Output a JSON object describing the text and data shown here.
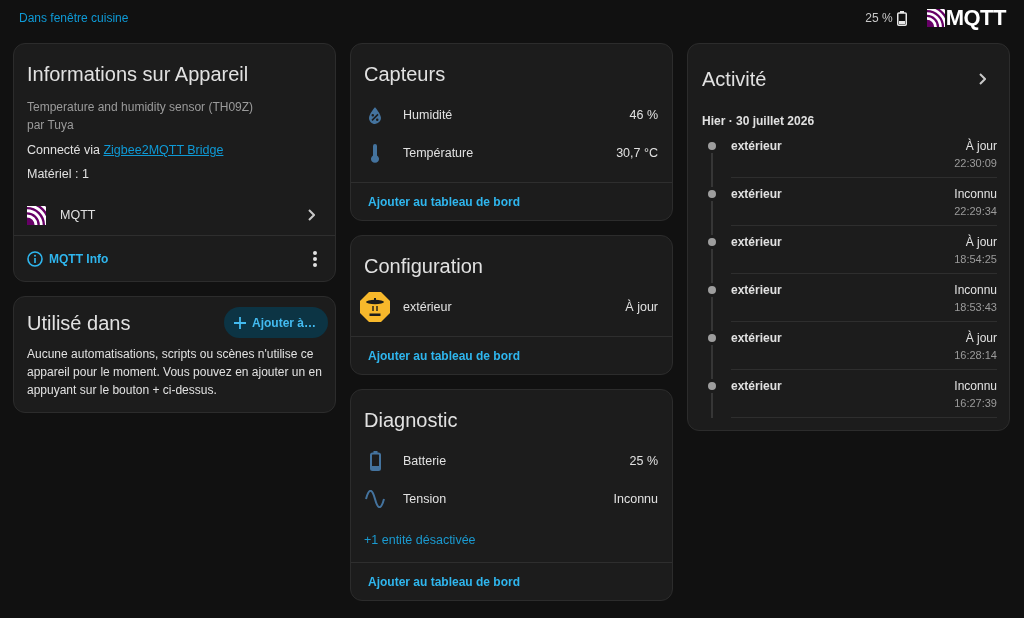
{
  "header": {
    "area": "Dans fenêtre cuisine",
    "battery": "25 %",
    "brand": "MQTT"
  },
  "device_info": {
    "title": "Informations sur Appareil",
    "model": "Temperature and humidity sensor (TH09Z)",
    "manufacturer": "par Tuya",
    "connection": {
      "label": "Connecté via",
      "link": "Zigbee2MQTT Bridge"
    },
    "hardware": "Matériel : 1",
    "integration": "MQTT",
    "action": "MQTT Info"
  },
  "used_in": {
    "title": "Utilisé dans",
    "button": "Ajouter à…",
    "message": "Aucune automatisations, scripts ou scènes n'utilise ce appareil pour le moment. Vous pouvez en ajouter un en appuyant sur le bouton + ci-dessus."
  },
  "sensors": {
    "title": "Capteurs",
    "entities": [
      {
        "kind": "humidity",
        "name": "Humidité",
        "value": "46 %"
      },
      {
        "kind": "temperature",
        "name": "Température",
        "value": "30,7 °C"
      }
    ],
    "footer_link": "Ajouter au tableau de bord"
  },
  "configuration": {
    "title": "Configuration",
    "entities": [
      {
        "kind": "update",
        "name": "extérieur",
        "value": "À jour"
      }
    ],
    "footer_link": "Ajouter au tableau de bord"
  },
  "diagnostic": {
    "title": "Diagnostic",
    "entities": [
      {
        "kind": "battery",
        "name": "Batterie",
        "value": "25 %"
      },
      {
        "kind": "voltage",
        "name": "Tension",
        "value": "Inconnu"
      }
    ],
    "hidden_entities": "+1 entité désactivée",
    "footer_link": "Ajouter au tableau de bord"
  },
  "activity": {
    "title": "Activité",
    "date": "Hier · 30 juillet 2026",
    "entries": [
      {
        "name": "extérieur",
        "state": "À jour",
        "time": "22:30:09"
      },
      {
        "name": "extérieur",
        "state": "Inconnu",
        "time": "22:29:34"
      },
      {
        "name": "extérieur",
        "state": "À jour",
        "time": "18:54:25"
      },
      {
        "name": "extérieur",
        "state": "Inconnu",
        "time": "18:53:43"
      },
      {
        "name": "extérieur",
        "state": "À jour",
        "time": "16:28:14"
      },
      {
        "name": "extérieur",
        "state": "Inconnu",
        "time": "16:27:39"
      }
    ]
  }
}
